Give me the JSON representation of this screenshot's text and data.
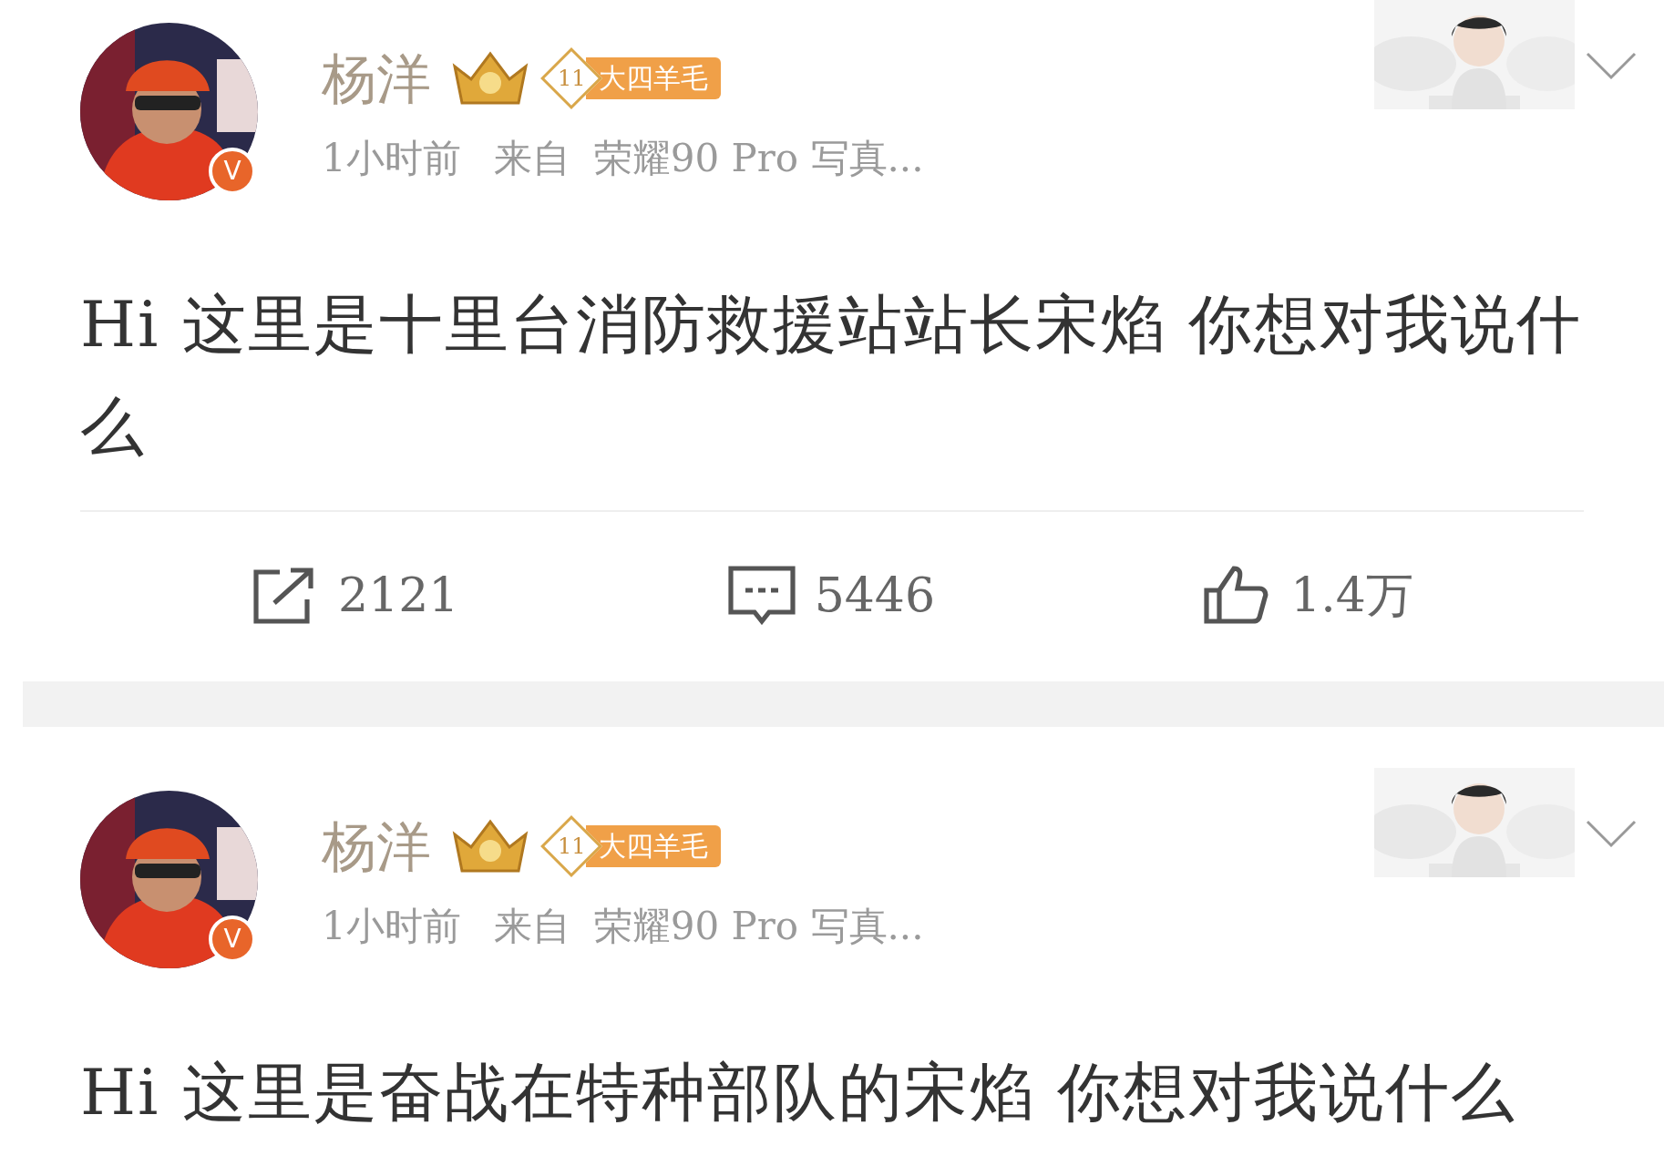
{
  "posts": [
    {
      "author": "杨洋",
      "level": "11",
      "badge": "大四羊毛",
      "verified_mark": "V",
      "time": "1小时前",
      "source_prefix": "来自",
      "source": "荣耀90 Pro 写真...",
      "text": "Hi 这里是十里台消防救援站站长宋焰 你想对我说什么",
      "actions": [
        {
          "kind": "repost",
          "count": "2121"
        },
        {
          "kind": "comment",
          "count": "5446"
        },
        {
          "kind": "like",
          "count": "1.4万"
        }
      ]
    },
    {
      "author": "杨洋",
      "level": "11",
      "badge": "大四羊毛",
      "verified_mark": "V",
      "time": "1小时前",
      "source_prefix": "来自",
      "source": "荣耀90 Pro 写真...",
      "text": "Hi 这里是奋战在特种部队的宋焰 你想对我说什么"
    }
  ]
}
